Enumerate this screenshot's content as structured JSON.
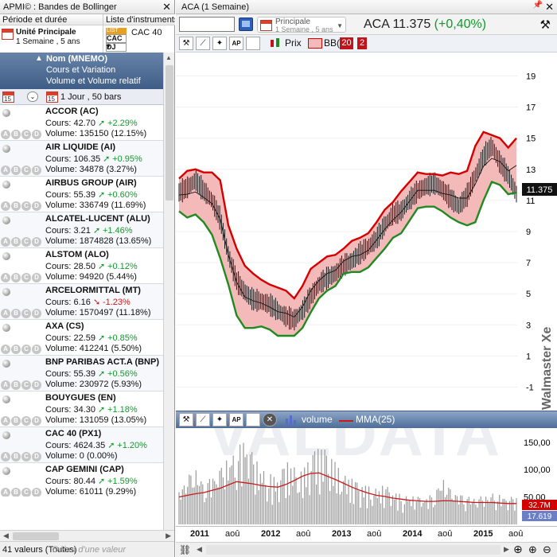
{
  "left_panel": {
    "title": "APMI© : Bandes de Bollinger",
    "close": "✕",
    "tab_period": {
      "header": "Période et durée",
      "line1": "Unité Principale",
      "line2": "1 Semaine , 5 ans"
    },
    "tab_lists": {
      "header": "Liste d'instruments",
      "selected": "CAC 40",
      "icons": [
        "LIST",
        "CAC",
        "DJ"
      ]
    },
    "column_header": {
      "sort_indicator": "▲",
      "line1": "Nom (MNEMO)",
      "line2": "Cours et Variation",
      "line3": "Volume et Volume relatif"
    },
    "period_row": {
      "calendar_day": "15",
      "dropdown_glyph": "⌄",
      "text": "1 Jour , 50 bars"
    },
    "stocks": [
      {
        "name": "ACCOR (AC)",
        "cours": "Cours: 42.70",
        "var": "+2.29%",
        "dir": "up",
        "volume": "Volume: 135150 (12.15%)"
      },
      {
        "name": "AIR LIQUIDE (AI)",
        "cours": "Cours: 106.35",
        "var": "+0.95%",
        "dir": "up",
        "volume": "Volume: 34878 (3.27%)"
      },
      {
        "name": "AIRBUS GROUP (AIR)",
        "cours": "Cours: 55.39",
        "var": "+0.60%",
        "dir": "up",
        "volume": "Volume: 336749 (11.69%)"
      },
      {
        "name": "ALCATEL-LUCENT (ALU)",
        "cours": "Cours: 3.21",
        "var": "+1.46%",
        "dir": "up",
        "volume": "Volume: 1874828 (13.65%)"
      },
      {
        "name": "ALSTOM (ALO)",
        "cours": "Cours: 28.50",
        "var": "+0.12%",
        "dir": "up",
        "volume": "Volume: 94920 (5.44%)"
      },
      {
        "name": "ARCELORMITTAL (MT)",
        "cours": "Cours: 6.16",
        "var": "-1.23%",
        "dir": "down",
        "volume": "Volume: 1570497 (11.18%)"
      },
      {
        "name": "AXA (CS)",
        "cours": "Cours: 22.59",
        "var": "+0.85%",
        "dir": "up",
        "volume": "Volume: 412241 (5.50%)"
      },
      {
        "name": "BNP PARIBAS ACT.A (BNP)",
        "cours": "Cours: 55.39",
        "var": "+0.56%",
        "dir": "up",
        "volume": "Volume: 230972 (5.93%)"
      },
      {
        "name": "BOUYGUES (EN)",
        "cours": "Cours: 34.30",
        "var": "+1.18%",
        "dir": "up",
        "volume": "Volume: 131059 (13.05%)"
      },
      {
        "name": "CAC 40 (PX1)",
        "cours": "Cours: 4624.35",
        "var": "+1.20%",
        "dir": "up",
        "volume": "Volume: 0 (0.00%)"
      },
      {
        "name": "CAP GEMINI (CAP)",
        "cours": "Cours: 80.44",
        "var": "+1.59%",
        "dir": "up",
        "volume": "Volume: 61011 (9.29%)"
      }
    ],
    "abcd": [
      "A",
      "B",
      "C",
      "D"
    ],
    "status_count": "41 valeurs (Toutes)",
    "search_placeholder": "Début d'une valeur"
  },
  "right_panel": {
    "title": "ACA (1 Semaine)",
    "pin": "📌",
    "close": "✕",
    "symbol_input": "",
    "principale": {
      "line1": "Principale",
      "line2": "1 Semaine , 5 ans"
    },
    "quote": {
      "symbol": "ACA",
      "price": "11.375",
      "change": "(+0,40%)"
    },
    "chart_toolbar": {
      "prix_label": "Prix",
      "bb_label": "BB(",
      "bb_period": "20",
      "bb_dev": "2"
    },
    "volume_legend": {
      "volume_label": "volume",
      "mma_label": "MMA(25)"
    },
    "watermark": "VALDATA",
    "vertical_watermark": "Walmaster Xe",
    "icons": [
      "hammer-icon",
      "book-icon",
      "chart-line-icon",
      "candle-icon"
    ],
    "colors": {
      "band_upper": "#d40000",
      "band_lower": "#1f8a1f",
      "band_fill": "#f4b9b9",
      "mma": "#c81a1a",
      "volume": "#8a8a8a"
    }
  },
  "chart_data": [
    {
      "type": "line",
      "title": "ACA (1 Semaine)",
      "series_labels": [
        "Prix",
        "BB(20,2)"
      ],
      "ylim": [
        -2,
        20
      ],
      "yticks": [
        "19",
        "17",
        "15",
        "13",
        "11",
        "9",
        "7",
        "5",
        "3",
        "1",
        "-1"
      ],
      "last_price_label": "11.375",
      "x": [
        "2011",
        "aoû",
        "2012",
        "aoû",
        "2013",
        "aoû",
        "2014",
        "aoû",
        "2015",
        "aoû"
      ],
      "series": [
        {
          "name": "Prix",
          "values": [
            11.5,
            11.8,
            12.3,
            11.6,
            11.0,
            9.8,
            7.5,
            5.8,
            5.1,
            4.6,
            4.5,
            4.3,
            3.9,
            3.5,
            3.3,
            3.9,
            4.8,
            5.6,
            6.0,
            6.3,
            6.8,
            7.1,
            7.6,
            8.0,
            8.5,
            9.4,
            10.1,
            10.3,
            11.0,
            11.6,
            11.9,
            12.1,
            11.7,
            11.1,
            10.6,
            11.3,
            12.6,
            13.8,
            14.5,
            13.4,
            12.6,
            11.4
          ]
        },
        {
          "name": "BB Haute",
          "values": [
            12.4,
            12.9,
            13.0,
            12.8,
            12.8,
            12.3,
            9.4,
            7.9,
            6.8,
            6.3,
            5.9,
            5.6,
            5.4,
            5.2,
            4.7,
            5.5,
            6.6,
            7.0,
            7.4,
            7.5,
            7.9,
            8.4,
            8.6,
            8.9,
            9.6,
            10.4,
            10.9,
            11.6,
            12.2,
            12.8,
            12.7,
            12.7,
            12.6,
            12.8,
            12.7,
            12.9,
            14.5,
            15.4,
            15.2,
            15.0,
            14.4,
            15.0
          ]
        },
        {
          "name": "BB Basse",
          "values": [
            10.3,
            9.9,
            10.1,
            9.6,
            8.8,
            7.3,
            5.6,
            3.6,
            2.8,
            2.8,
            2.9,
            2.7,
            2.3,
            2.3,
            2.3,
            2.8,
            3.8,
            4.7,
            5.2,
            5.5,
            6.3,
            6.4,
            6.4,
            6.7,
            7.3,
            7.9,
            8.6,
            8.9,
            9.7,
            10.5,
            10.6,
            10.6,
            10.3,
            9.9,
            9.6,
            9.4,
            9.6,
            11.0,
            12.2,
            12.0,
            11.4,
            11.5
          ]
        }
      ]
    },
    {
      "type": "bar",
      "title": "volume",
      "ylim": [
        0,
        170
      ],
      "yticks": [
        "150,00",
        "100,00",
        "50,00"
      ],
      "last_labels": [
        "32.7M",
        "17.619"
      ],
      "series": [
        {
          "name": "volume",
          "values": [
            45,
            60,
            72,
            55,
            62,
            70,
            85,
            96,
            110,
            88,
            70,
            64,
            58,
            80,
            72,
            66,
            90,
            98,
            94,
            78,
            62,
            58,
            52,
            48,
            45,
            50,
            42,
            38,
            36,
            35,
            34,
            42,
            60,
            44,
            40,
            38,
            34,
            36,
            40,
            38,
            36,
            34
          ]
        },
        {
          "name": "MMA(25)",
          "values": [
            50,
            53,
            56,
            58,
            62,
            66,
            72,
            78,
            76,
            74,
            71,
            69,
            68,
            73,
            80,
            88,
            93,
            94,
            88,
            82,
            75,
            68,
            62,
            57,
            53,
            51,
            48,
            46,
            44,
            43,
            42,
            42,
            43,
            43,
            42,
            41,
            40,
            40,
            40,
            39,
            38,
            38
          ]
        }
      ]
    }
  ]
}
